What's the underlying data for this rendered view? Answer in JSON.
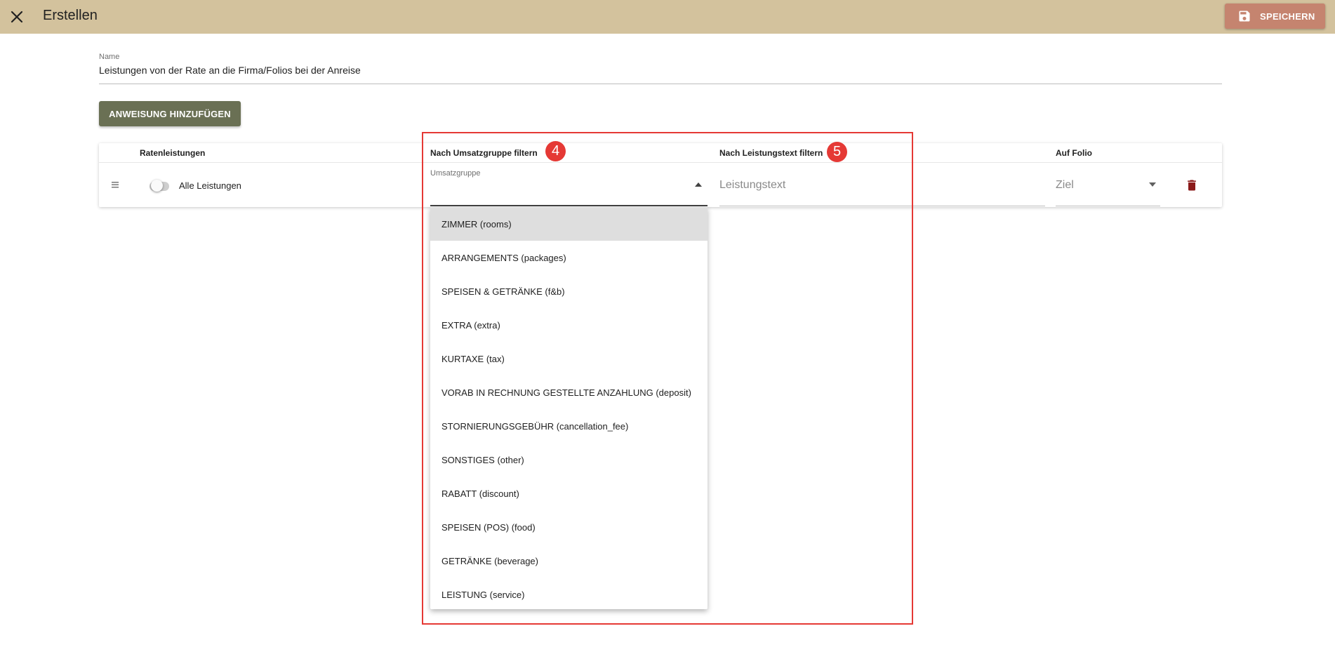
{
  "header": {
    "title": "Erstellen",
    "save_label": "SPEICHERN",
    "close_icon": "close-icon",
    "save_icon": "floppy-disk-icon",
    "bar_color": "#d3c29d",
    "save_color": "#c5846f"
  },
  "form": {
    "name_label": "Name",
    "name_value": "Leistungen von der Rate an die Firma/Folios bei der Anreise",
    "add_button_label": "ANWEISUNG HINZUFÜGEN",
    "add_button_color": "#6a7054"
  },
  "table": {
    "columns": [
      "Ratenleistungen",
      "Nach Umsatzgruppe filtern",
      "Nach Leistungstext filtern",
      "Auf Folio"
    ],
    "row": {
      "toggle_label": "Alle Leistungen",
      "toggle_on": false,
      "group_select_label": "Umsatzgruppe",
      "text_placeholder": "Leistungstext",
      "folio_placeholder": "Ziel",
      "delete_icon": "trash-icon",
      "delete_color": "#8b1a1a"
    }
  },
  "dropdown": {
    "options": [
      "ZIMMER (rooms)",
      "ARRANGEMENTS (packages)",
      "SPEISEN & GETRÄNKE (f&b)",
      "EXTRA (extra)",
      "KURTAXE (tax)",
      "VORAB IN RECHNUNG GESTELLTE ANZAHLUNG (deposit)",
      "STORNIERUNGSGEBÜHR (cancellation_fee)",
      "SONSTIGES (other)",
      "RABATT (discount)",
      "SPEISEN (POS) (food)",
      "GETRÄNKE (beverage)",
      "LEISTUNG (service)"
    ],
    "highlighted": "ZIMMER (rooms)"
  },
  "annotations": {
    "badge_4": "4",
    "badge_5": "5",
    "color": "#e53935"
  }
}
